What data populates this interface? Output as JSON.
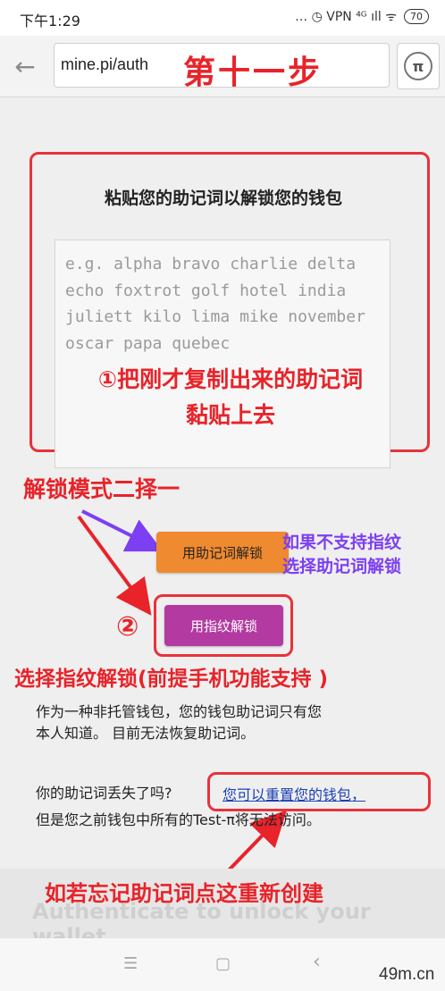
{
  "status_bar": {
    "time": "下午1:29",
    "icons": "… ◷ VPN ⁴ᴳ ıll ᯤ",
    "battery": "70"
  },
  "browser": {
    "back_icon": "←",
    "url": "mine.pi/auth",
    "pi_icon": "π"
  },
  "annotations": {
    "step": "第十一步",
    "paste_line1": "①把刚才复制出来的助记词",
    "paste_line2": "黏贴上去",
    "choose_mode": "解锁模式二择一",
    "no_fp_line1": "如果不支持指纹",
    "no_fp_line2": "选择助记词解锁",
    "circle_two": "②",
    "choose_fp": "选择指纹解锁(前提手机功能支持 )",
    "forgot_recreate": "如若忘记助记词点这重新创建"
  },
  "main": {
    "heading": "粘贴您的助记词以解锁您的钱包",
    "mnemonic_placeholder": "e.g. alpha bravo charlie delta echo foxtrot golf hotel india juliett kilo lima mike november oscar papa quebec",
    "unlock_mnemonic_label": "用助记词解锁",
    "unlock_fingerprint_label": "用指纹解锁",
    "info_line1": "作为一种非托管钱包，您的钱包助记词只有您",
    "info_line2": "本人知道。 目前无法恢复助记词。",
    "lost_question": "你的助记词丢失了吗?",
    "reset_link": "您可以重置您的钱包，",
    "lost_line2": "但是您之前钱包中所有的Test-π将无法访问。",
    "auth_banner": "Authenticate to unlock your wallet"
  },
  "bottom_nav": {
    "menu_icon": "☰",
    "home_icon": "▢",
    "back_icon": "‹"
  },
  "watermark": "49m.cn",
  "colors": {
    "annotation_red": "#e8232a",
    "annotation_purple": "#7c3ff2",
    "mnemonic_button": "#f08a30",
    "fingerprint_button": "#b23aa1",
    "link": "#1b3fb5"
  }
}
